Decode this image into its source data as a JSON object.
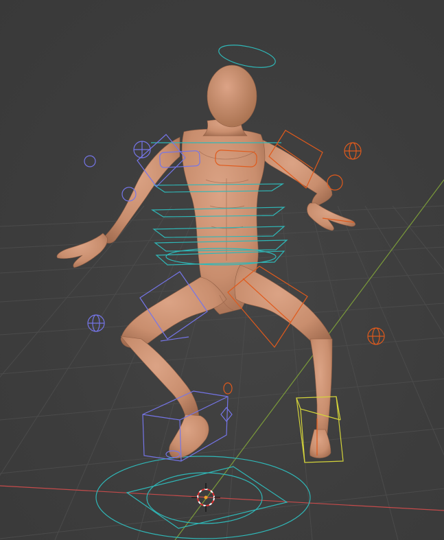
{
  "viewport": {
    "background": "#3d3d3d",
    "grid_color": "#4a4a4a",
    "x_axis_color": "#c64b4b",
    "y_axis_color": "#7b9b3a"
  },
  "mannequin": {
    "skin_color": "#c98e6e",
    "skin_shade": "#a66e50"
  },
  "rig": {
    "left_side_color": "#7575e8",
    "right_side_color": "#e05a1c",
    "center_color": "#2fb8b8",
    "ik_target_color": "#d4d43a",
    "cursor_icon": "3d-cursor-icon"
  }
}
